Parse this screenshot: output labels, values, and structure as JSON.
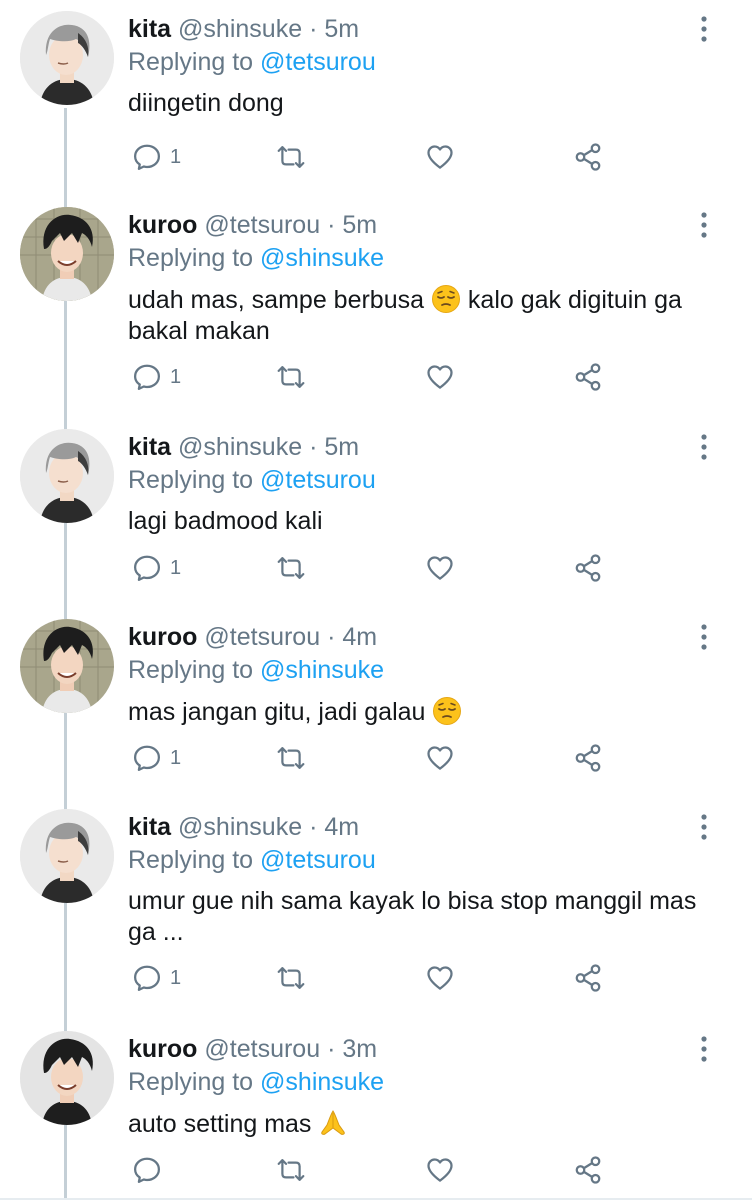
{
  "colors": {
    "accent": "#1da1f2",
    "secondary_text": "#657786",
    "primary_text": "#14171a",
    "thread_line": "#c4cfd6"
  },
  "tweets": [
    {
      "avatar": "kita-avatar",
      "name": "kita",
      "handle": "@shinsuke",
      "dot": "·",
      "time": "5m",
      "replying_label": "Replying to",
      "replying_to": "@tetsurou",
      "text": "diingetin dong",
      "emoji": "",
      "reply_count": "1"
    },
    {
      "avatar": "kuroo-avatar",
      "name": "kuroo",
      "handle": "@tetsurou",
      "dot": "·",
      "time": "5m",
      "replying_label": "Replying to",
      "replying_to": "@shinsuke",
      "text_before": "udah mas, sampe berbusa",
      "emoji": "pensive-face",
      "text_after": "kalo gak digituin ga bakal makan",
      "reply_count": "1"
    },
    {
      "avatar": "kita-avatar",
      "name": "kita",
      "handle": "@shinsuke",
      "dot": "·",
      "time": "5m",
      "replying_label": "Replying to",
      "replying_to": "@tetsurou",
      "text": "lagi badmood kali",
      "emoji": "",
      "reply_count": "1"
    },
    {
      "avatar": "kuroo-avatar",
      "name": "kuroo",
      "handle": "@tetsurou",
      "dot": "·",
      "time": "4m",
      "replying_label": "Replying to",
      "replying_to": "@shinsuke",
      "text": "mas jangan gitu, jadi galau",
      "emoji": "pensive-face",
      "reply_count": "1"
    },
    {
      "avatar": "kita-avatar",
      "name": "kita",
      "handle": "@shinsuke",
      "dot": "·",
      "time": "4m",
      "replying_label": "Replying to",
      "replying_to": "@tetsurou",
      "text": "umur gue nih sama kayak lo bisa stop manggil mas ga ...",
      "emoji": "",
      "reply_count": "1"
    },
    {
      "avatar": "kuroo-avatar",
      "name": "kuroo",
      "handle": "@tetsurou",
      "dot": "·",
      "time": "3m",
      "replying_label": "Replying to",
      "replying_to": "@shinsuke",
      "text": "auto setting mas",
      "emoji": "folded-hands",
      "reply_count": ""
    }
  ],
  "icons": {
    "reply": "reply-icon",
    "retweet": "retweet-icon",
    "like": "heart-icon",
    "share": "share-icon",
    "more": "more-vertical-icon"
  }
}
